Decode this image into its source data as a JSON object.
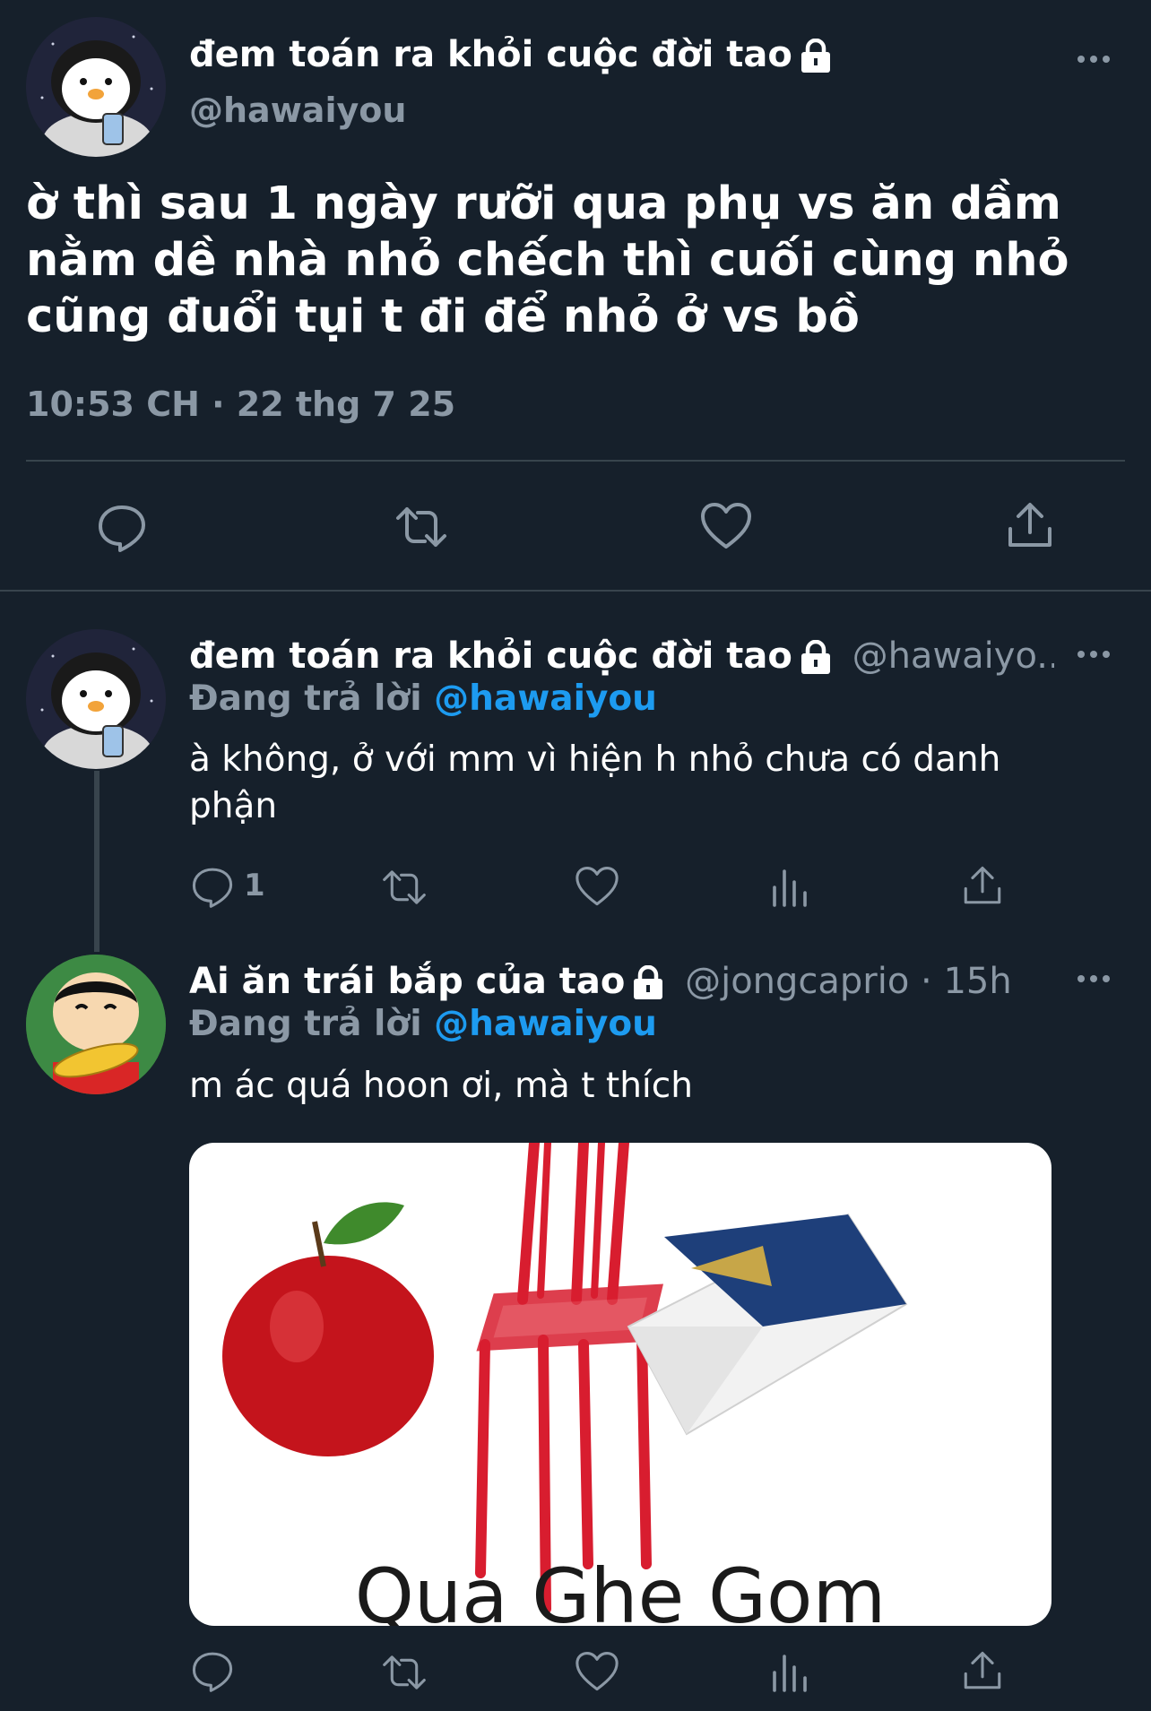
{
  "main_tweet": {
    "display_name": "đem toán ra khỏi cuộc đời tao",
    "handle": "@hawaiyou",
    "text_lines": [
      "ờ thì sau 1 ngày rưỡi qua phụ vs ăn dầm",
      "nằm dề nhà nhỏ chếch thì cuối cùng nhỏ",
      "cũng đuổi tụi t đi để nhỏ ở vs bồ"
    ],
    "timestamp": "10:53 CH · 22 thg 7 25"
  },
  "reply1": {
    "display_name": "đem toán ra khỏi cuộc đời tao",
    "handle": "@hawaiyo...",
    "replying_prefix": "Đang trả lời",
    "replying_to": "@hawaiyou",
    "text_lines": [
      "à không, ở với mm vì hiện h nhỏ chưa có danh",
      "phận"
    ],
    "reply_count": "1"
  },
  "reply2": {
    "display_name": "Ai ăn trái bắp của tao",
    "handle": "@jongcaprio · 15h",
    "replying_prefix": "Đang trả lời",
    "replying_to": "@hawaiyou",
    "text": "m ác quá hoon ơi, mà t thích",
    "image_caption": "Qua Ghe Gom"
  },
  "colors": {
    "background": "#16202b",
    "muted": "#8b98a5",
    "link": "#1d9bf0",
    "divider": "#38444d"
  },
  "icons": [
    "lock-icon",
    "more-icon",
    "reply-icon",
    "retweet-icon",
    "like-icon",
    "share-icon",
    "analytics-icon"
  ]
}
